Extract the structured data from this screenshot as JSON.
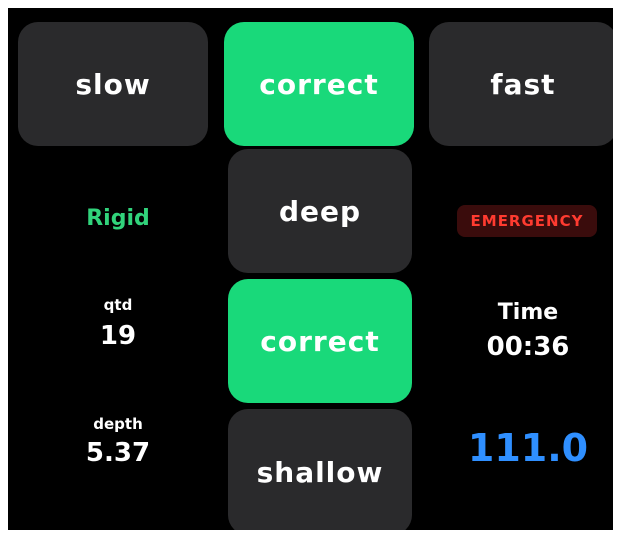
{
  "colors": {
    "background": "#000000",
    "tile_gray": "#2a2a2c",
    "tile_green": "#19d97a",
    "status_green": "#31d37b",
    "emergency_red": "#ff3b30",
    "emergency_bg": "#3a0c0c",
    "value_blue": "#2f8fff"
  },
  "rate": {
    "slow_label": "slow",
    "correct_label": "correct",
    "fast_label": "fast"
  },
  "depth_buttons": {
    "deep_label": "deep",
    "correct_label": "correct",
    "shallow_label": "shallow"
  },
  "status": {
    "mode": "Rigid",
    "emergency_label": "EMERGENCY"
  },
  "stats": {
    "qtd_label": "qtd",
    "qtd_value": "19",
    "depth_label": "depth",
    "depth_value": "5.37",
    "time_label": "Time",
    "time_value": "00:36",
    "reading_value": "111.0"
  }
}
